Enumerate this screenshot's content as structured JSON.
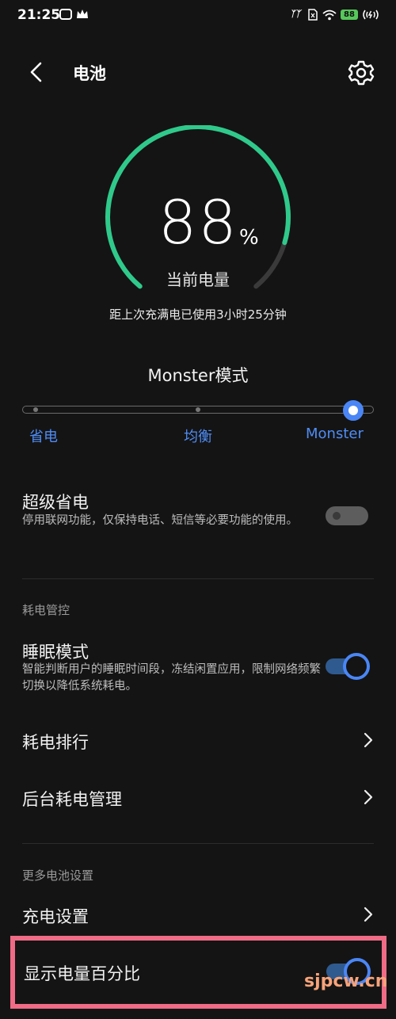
{
  "status_bar": {
    "time": "21:25",
    "battery_level": "88",
    "icons": [
      "app-icon",
      "crown-icon",
      "signal-icon",
      "sim-icon",
      "wifi-icon",
      "battery-icon",
      "hotspot-icon"
    ]
  },
  "header": {
    "title": "电池",
    "back_icon": "back-arrow-icon",
    "settings_icon": "gear-icon"
  },
  "battery_gauge": {
    "percent_value": "88",
    "percent_unit": "%",
    "level_fraction": 0.88,
    "label": "当前电量",
    "usage_text": "距上次充满电已使用3小时25分钟",
    "fill_color": "#2fca8b",
    "track_color": "#3a3a3a"
  },
  "mode": {
    "title": "Monster模式",
    "options": [
      "省电",
      "均衡",
      "Monster"
    ],
    "selected": "Monster",
    "accent_color": "#4f8df6"
  },
  "super_save": {
    "title": "超级省电",
    "description": "停用联网功能，仅保持电话、短信等必要功能的使用。",
    "enabled": false
  },
  "section_power": {
    "header": "耗电管控",
    "sleep_mode": {
      "title": "睡眠模式",
      "description": "智能判断用户的睡眠时间段，冻结闲置应用，限制网络频繁切换以降低系统耗电。",
      "enabled": true
    },
    "ranking": {
      "title": "耗电排行"
    },
    "background": {
      "title": "后台耗电管理"
    }
  },
  "section_more": {
    "header": "更多电池设置",
    "charge_settings": {
      "title": "充电设置"
    },
    "show_percentage": {
      "title": "显示电量百分比",
      "enabled": true
    }
  },
  "watermark": "sjpcw.cn"
}
